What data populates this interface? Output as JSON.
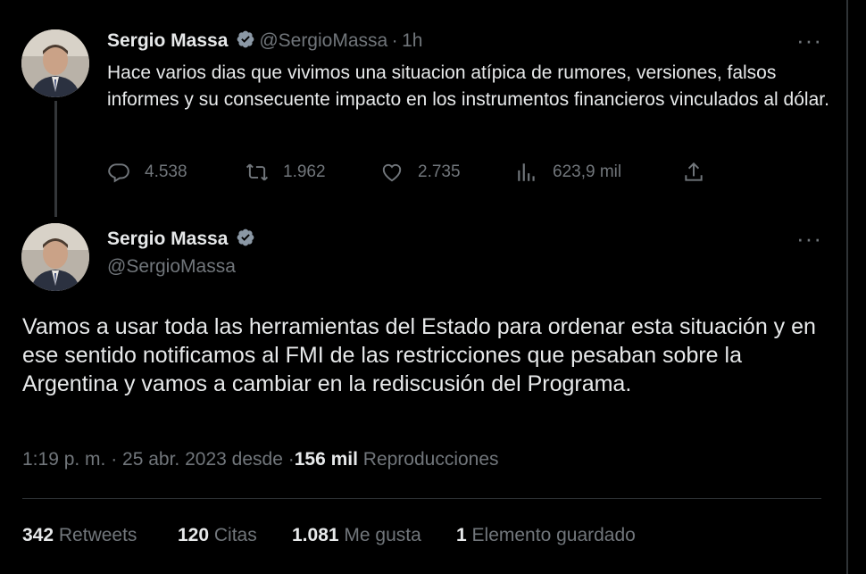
{
  "colors": {
    "background": "#000000",
    "text": "#e7e9ea",
    "muted": "#71767b",
    "verified": "#8b98a5",
    "border": "#2f3336"
  },
  "tweet1": {
    "author_name": "Sergio Massa",
    "handle": "@SergioMassa",
    "separator": "·",
    "time": "1h",
    "more_icon": "more-horizontal-icon",
    "text": "Hace varios dias que vivimos una situacion atípica de rumores, versiones, falsos informes y su consecuente impacto en los instrumentos financieros vinculados al dólar.",
    "actions": {
      "replies": "4.538",
      "retweets": "1.962",
      "likes": "2.735",
      "views": "623,9 mil"
    }
  },
  "tweet2": {
    "author_name": "Sergio Massa",
    "handle": "@SergioMassa",
    "more_icon": "more-horizontal-icon",
    "text": "Vamos a usar toda las herramientas del Estado para ordenar esta situación y en ese sentido notificamos al FMI de las restricciones que pesaban sobre la Argentina y vamos a cambiar en la rediscusión del Programa.",
    "timestamp": "1:19 p. m. · 25 abr. 2023 desde",
    "separator": "·",
    "views_count": "156 mil",
    "views_label": "Reproducciones",
    "stats": {
      "retweets_count": "342",
      "retweets_label": "Retweets",
      "quotes_count": "120",
      "quotes_label": "Citas",
      "likes_count": "1.081",
      "likes_label": "Me gusta",
      "bookmarks_count": "1",
      "bookmarks_label": "Elemento guardado"
    }
  }
}
